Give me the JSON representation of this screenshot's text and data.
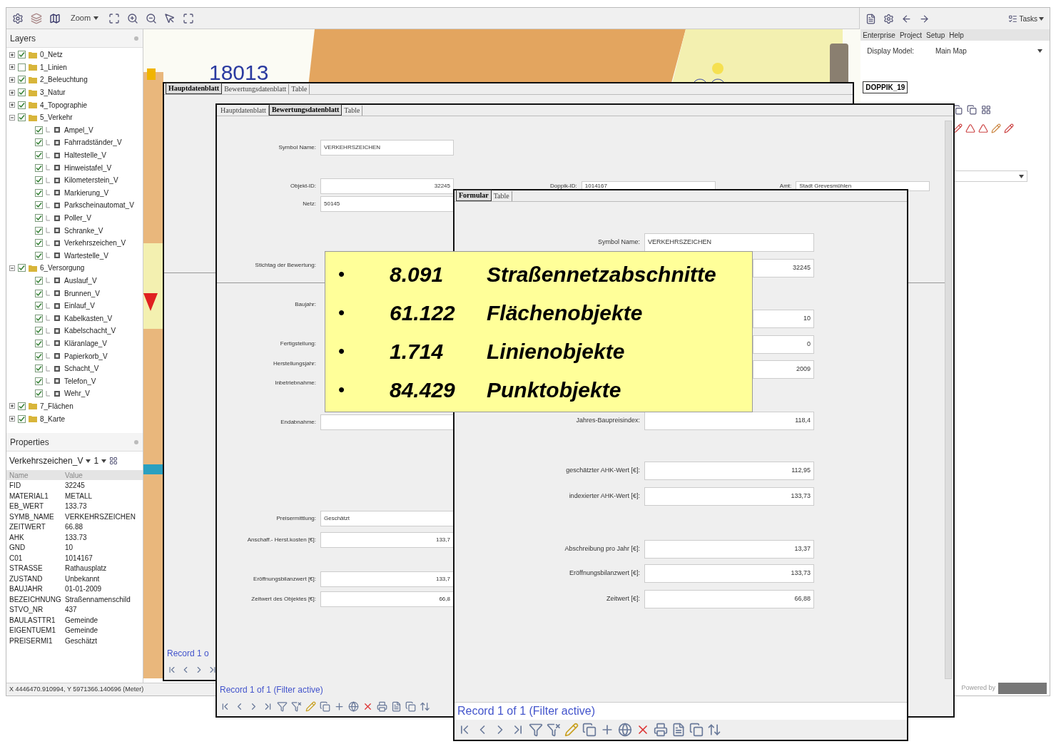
{
  "toolbar": {
    "zoom_label": "Zoom"
  },
  "layers_panel": {
    "title": "Layers",
    "layers": [
      {
        "label": "0_Netz",
        "checked": true,
        "expanded": false
      },
      {
        "label": "1_Linien",
        "checked": false,
        "expanded": false
      },
      {
        "label": "2_Beleuchtung",
        "checked": true,
        "expanded": false
      },
      {
        "label": "3_Natur",
        "checked": true,
        "expanded": false
      },
      {
        "label": "4_Topographie",
        "checked": true,
        "expanded": false
      },
      {
        "label": "5_Verkehr",
        "checked": true,
        "expanded": true,
        "children": [
          {
            "label": "Ampel_V",
            "checked": true
          },
          {
            "label": "Fahrradständer_V",
            "checked": true
          },
          {
            "label": "Haltestelle_V",
            "checked": true
          },
          {
            "label": "Hinweistafel_V",
            "checked": true
          },
          {
            "label": "Kilometerstein_V",
            "checked": true
          },
          {
            "label": "Markierung_V",
            "checked": true
          },
          {
            "label": "Parkscheinautomat_V",
            "checked": true
          },
          {
            "label": "Poller_V",
            "checked": true
          },
          {
            "label": "Schranke_V",
            "checked": true
          },
          {
            "label": "Verkehrszeichen_V",
            "checked": true
          },
          {
            "label": "Wartestelle_V",
            "checked": true
          }
        ]
      },
      {
        "label": "6_Versorgung",
        "checked": true,
        "expanded": true,
        "children": [
          {
            "label": "Auslauf_V",
            "checked": true
          },
          {
            "label": "Brunnen_V",
            "checked": true
          },
          {
            "label": "Einlauf_V",
            "checked": true
          },
          {
            "label": "Kabelkasten_V",
            "checked": true
          },
          {
            "label": "Kabelschacht_V",
            "checked": true
          },
          {
            "label": "Kläranlage_V",
            "checked": true
          },
          {
            "label": "Papierkorb_V",
            "checked": true
          },
          {
            "label": "Schacht_V",
            "checked": true
          },
          {
            "label": "Telefon_V",
            "checked": true
          },
          {
            "label": "Wehr_V",
            "checked": true
          }
        ]
      },
      {
        "label": "7_Flächen",
        "checked": true,
        "expanded": false
      },
      {
        "label": "8_Karte",
        "checked": true,
        "expanded": false
      }
    ]
  },
  "properties_panel": {
    "title": "Properties",
    "layer": "Verkehrszeichen_V",
    "index": "1",
    "columns": [
      "Name",
      "Value"
    ],
    "rows": [
      [
        "FID",
        "32245"
      ],
      [
        "MATERIAL1",
        "METALL"
      ],
      [
        "EB_WERT",
        "133.73"
      ],
      [
        "SYMB_NAME",
        "VERKEHRSZEICHEN"
      ],
      [
        "ZEITWERT",
        "66.88"
      ],
      [
        "AHK",
        "133.73"
      ],
      [
        "GND",
        "10"
      ],
      [
        "C01",
        "1014167"
      ],
      [
        "STRASSE",
        "Rathausplatz"
      ],
      [
        "ZUSTAND",
        "Unbekannt"
      ],
      [
        "BAUJAHR",
        "01-01-2009"
      ],
      [
        "BEZEICHNUNG",
        "Straßennamenschild"
      ],
      [
        "STVO_NR",
        "437"
      ],
      [
        "BAULASTTR1",
        "Gemeinde"
      ],
      [
        "EIGENTUEM1",
        "Gemeinde"
      ],
      [
        "PREISERMI1",
        "Geschätzt"
      ]
    ]
  },
  "map": {
    "label": "18013"
  },
  "status_bar": "X 4446470.910994, Y 5971366.140696 (Meter)",
  "right_panel": {
    "tasks_label": "Tasks",
    "menu": [
      "Enterprise",
      "Project",
      "Setup",
      "Help"
    ],
    "display_model_label": "Display Model:",
    "display_model_value": "Main Map",
    "tab": "DOPPIK_19",
    "powered_by": "Powered by"
  },
  "back_form": {
    "tabs": [
      {
        "label": "Hauptdatenblatt",
        "selected": true
      },
      {
        "label": "Bewertungsdatenblatt",
        "selected": false
      },
      {
        "label": "Table",
        "selected": false
      }
    ],
    "record": "Record 1 o"
  },
  "middle_form": {
    "tabs": [
      {
        "label": "Hauptdatenblatt",
        "selected": false
      },
      {
        "label": "Bewertungsdatenblatt",
        "selected": true
      },
      {
        "label": "Table",
        "selected": false
      }
    ],
    "rows": [
      {
        "label": "Symbol Name:",
        "value": "VERKEHRSZEICHEN",
        "kind": "text"
      },
      {
        "label": "Objekt-ID:",
        "value": "32245",
        "kind": "number",
        "extras": [
          {
            "label": "Doppik-ID:",
            "value": "1014167"
          },
          {
            "label": "Amt:",
            "value": "Stadt Grevesmühlen"
          }
        ]
      },
      {
        "label": "Netz:",
        "value": "50145",
        "kind": "text"
      },
      {
        "label": "Stichtag der Bewertung:"
      },
      {
        "label": "Baujahr:",
        "divider_before": true
      },
      {
        "label": "Fertigstellung:"
      },
      {
        "label": "Herstellungsjahr:"
      },
      {
        "label": "Inbetriebnahme:"
      },
      {
        "label": "Endabnahme:"
      },
      {
        "label": "Preisermittlung:",
        "value": "Geschätzt",
        "kind": "text"
      },
      {
        "label": "Anschaff.- Herst.kosten [€]:",
        "value": "133,7",
        "kind": "number"
      },
      {
        "label": "Eröffnungsbilanzwert [€]:",
        "value": "133,7",
        "kind": "number"
      },
      {
        "label": "Zeitwert des Objektes [€]:",
        "value": "66,8",
        "kind": "number"
      }
    ],
    "record": "Record 1 of 1 (Filter active)"
  },
  "front_form": {
    "tabs": [
      {
        "label": "Formular",
        "selected": true
      },
      {
        "label": "Table",
        "selected": false
      }
    ],
    "rows": [
      {
        "label": "Symbol Name:",
        "value": "VERKEHRSZEICHEN",
        "kind": "text"
      },
      {
        "value": "32245",
        "kind": "number"
      },
      {
        "value": "10",
        "kind": "number"
      },
      {
        "value": "0",
        "kind": "number"
      },
      {
        "value": "2009",
        "kind": "number"
      },
      {
        "label": "Jahres-Baupreisindex:",
        "value": "118,4",
        "kind": "number"
      },
      {
        "label": "geschätzter AHK-Wert [€]:",
        "value": "112,95",
        "kind": "number"
      },
      {
        "label": "indexierter AHK-Wert [€]:",
        "value": "133,73",
        "kind": "number"
      },
      {
        "label": "Abschreibung pro Jahr [€]:",
        "value": "13,37",
        "kind": "number"
      },
      {
        "label": "Eröffnungsbilanzwert [€]:",
        "value": "133,73",
        "kind": "number"
      },
      {
        "label": "Zeitwert [€]:",
        "value": "66,88",
        "kind": "number"
      }
    ],
    "record": "Record 1 of 1 (Filter active)"
  },
  "callout": {
    "items": [
      {
        "bullet": "•",
        "count": "8.091",
        "label": "Straßennetzabschnitte"
      },
      {
        "bullet": "•",
        "count": "61.122",
        "label": "Flächenobjekte"
      },
      {
        "bullet": "•",
        "count": "1.714",
        "label": "Linienobjekte"
      },
      {
        "bullet": "•",
        "count": "84.429",
        "label": "Punktobjekte"
      }
    ]
  }
}
